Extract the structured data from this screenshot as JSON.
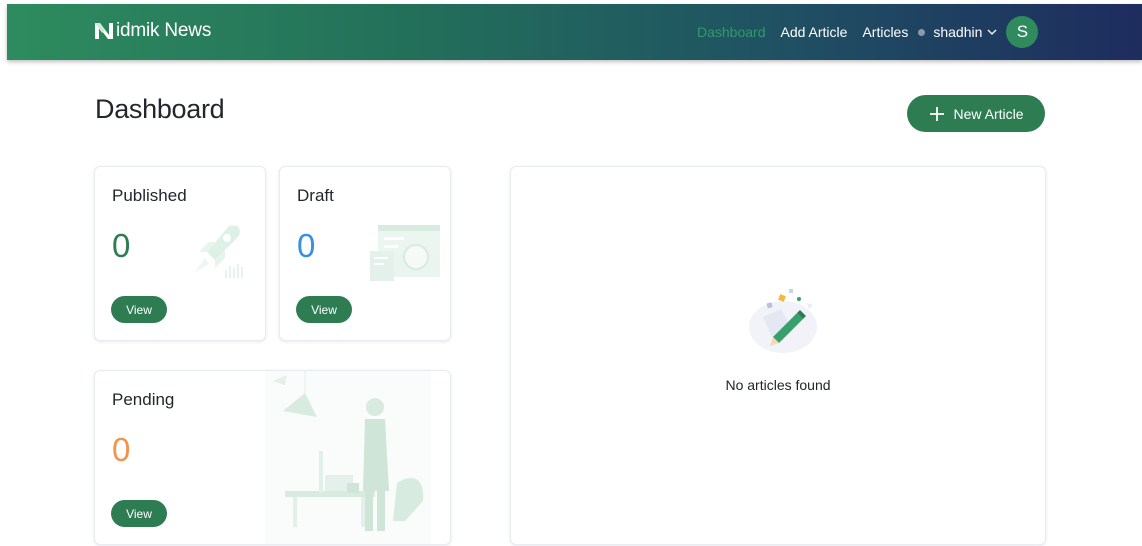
{
  "brand": {
    "name": "idmik News",
    "logo_letter": "N"
  },
  "nav": {
    "links": [
      {
        "label": "Dashboard",
        "active": true
      },
      {
        "label": "Add Article",
        "active": false
      },
      {
        "label": "Articles",
        "active": false
      }
    ],
    "user": {
      "name": "shadhin",
      "avatar_initial": "S"
    }
  },
  "page": {
    "title": "Dashboard",
    "new_article_label": "New Article"
  },
  "cards": {
    "published": {
      "title": "Published",
      "count": "0",
      "view_label": "View"
    },
    "draft": {
      "title": "Draft",
      "count": "0",
      "view_label": "View"
    },
    "pending": {
      "title": "Pending",
      "count": "0",
      "view_label": "View"
    }
  },
  "articles_panel": {
    "empty_message": "No articles found"
  },
  "colors": {
    "primary": "#2e7d52",
    "active_nav": "#2f9b6a",
    "published_count": "#2e7d52",
    "draft_count": "#3a8ee6",
    "pending_count": "#f0954d",
    "nav_gradient_start": "#2e8b5f",
    "nav_gradient_end": "#1e2c5e"
  },
  "icons": [
    "brand-logo-icon",
    "status-dot-icon",
    "chevron-down-icon",
    "plus-icon",
    "rocket-illustration",
    "browser-window-illustration",
    "person-office-illustration",
    "pen-empty-illustration"
  ]
}
